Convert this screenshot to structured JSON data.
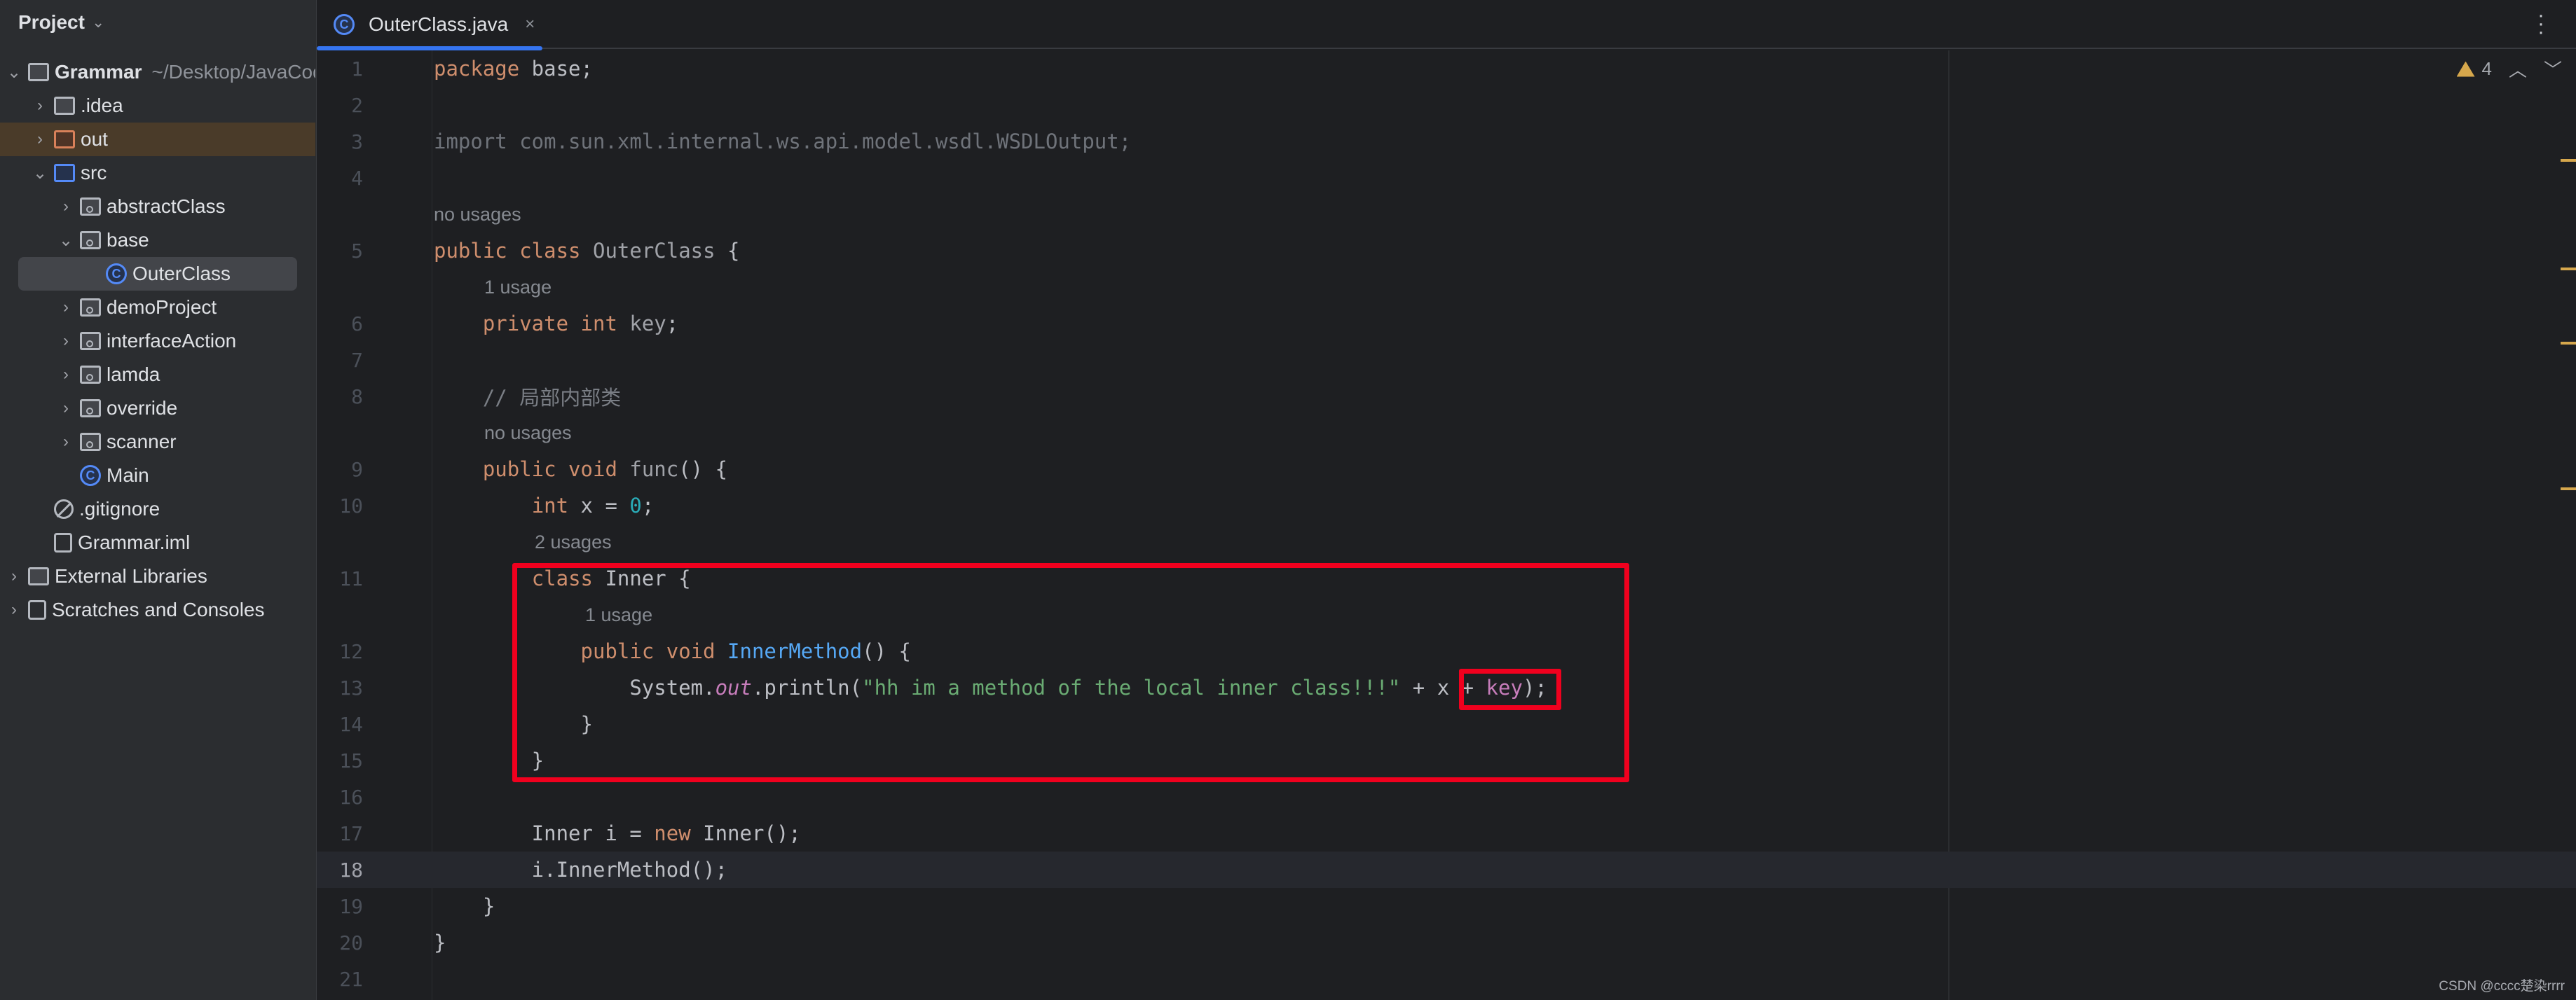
{
  "sidebar": {
    "title": "Project",
    "items": [
      {
        "label": "Grammar",
        "extra": "~/Desktop/JavaCod",
        "level": 0,
        "arrow": "down",
        "icon": "module-folder-icon"
      },
      {
        "label": ".idea",
        "level": 1,
        "arrow": "right",
        "icon": "folder-icon"
      },
      {
        "label": "out",
        "level": 1,
        "arrow": "right",
        "icon": "excluded-folder-icon",
        "highlight": true
      },
      {
        "label": "src",
        "level": 1,
        "arrow": "down",
        "icon": "source-folder-icon"
      },
      {
        "label": "abstractClass",
        "level": 2,
        "arrow": "right",
        "icon": "package-icon"
      },
      {
        "label": "base",
        "level": 2,
        "arrow": "down",
        "icon": "package-icon"
      },
      {
        "label": "OuterClass",
        "level": 3,
        "arrow": "",
        "icon": "class-icon",
        "selected": true
      },
      {
        "label": "demoProject",
        "level": 2,
        "arrow": "right",
        "icon": "package-icon"
      },
      {
        "label": "interfaceAction",
        "level": 2,
        "arrow": "right",
        "icon": "package-icon"
      },
      {
        "label": "lamda",
        "level": 2,
        "arrow": "right",
        "icon": "package-icon"
      },
      {
        "label": "override",
        "level": 2,
        "arrow": "right",
        "icon": "package-icon"
      },
      {
        "label": "scanner",
        "level": 2,
        "arrow": "right",
        "icon": "package-icon"
      },
      {
        "label": "Main",
        "level": 2,
        "arrow": "",
        "icon": "class-icon"
      },
      {
        "label": ".gitignore",
        "level": 1,
        "arrow": "",
        "icon": "ignore-file-icon"
      },
      {
        "label": "Grammar.iml",
        "level": 1,
        "arrow": "",
        "icon": "module-file-icon"
      },
      {
        "label": "External Libraries",
        "level": 0,
        "arrow": "right",
        "icon": "libraries-icon"
      },
      {
        "label": "Scratches and Consoles",
        "level": 0,
        "arrow": "right",
        "icon": "scratches-icon"
      }
    ]
  },
  "tab": {
    "label": "OuterClass.java",
    "close": "×",
    "icon_letter": "C"
  },
  "inspections": {
    "warnings": "4"
  },
  "current_line": "18",
  "rows": [
    {
      "ln": "1",
      "t": [
        [
          "package",
          "k"
        ],
        [
          " base;",
          ""
        ]
      ]
    },
    {
      "ln": "2",
      "t": []
    },
    {
      "ln": "3",
      "t": [
        [
          "import com.sun.xml.internal.ws.api.model.wsdl.WSDLOutput;",
          "g"
        ]
      ]
    },
    {
      "ln": "4",
      "t": []
    },
    {
      "inlay": "no usages",
      "indent": 0
    },
    {
      "ln": "5",
      "t": [
        [
          "public class",
          "k"
        ],
        [
          " ",
          ""
        ],
        [
          "OuterClass",
          "u"
        ],
        [
          " {",
          ""
        ]
      ]
    },
    {
      "inlay": "1 usage",
      "indent": 1
    },
    {
      "ln": "6",
      "t": [
        [
          "    ",
          ""
        ],
        [
          "private int",
          "k"
        ],
        [
          " ",
          ""
        ],
        [
          "key",
          "u"
        ],
        [
          ";",
          ""
        ]
      ]
    },
    {
      "ln": "7",
      "t": []
    },
    {
      "ln": "8",
      "t": [
        [
          "    ",
          ""
        ],
        [
          "// 局部内部类",
          "c"
        ]
      ]
    },
    {
      "inlay": "no usages",
      "indent": 1
    },
    {
      "ln": "9",
      "t": [
        [
          "    ",
          ""
        ],
        [
          "public void",
          "k"
        ],
        [
          " ",
          ""
        ],
        [
          "func",
          "u"
        ],
        [
          "() {",
          ""
        ]
      ]
    },
    {
      "ln": "10",
      "t": [
        [
          "        ",
          ""
        ],
        [
          "int",
          "k"
        ],
        [
          " x = ",
          ""
        ],
        [
          "0",
          "n"
        ],
        [
          ";",
          ""
        ]
      ]
    },
    {
      "inlay": "2 usages",
      "indent": 2
    },
    {
      "ln": "11",
      "t": [
        [
          "        ",
          ""
        ],
        [
          "class",
          "k"
        ],
        [
          " Inner {",
          ""
        ]
      ]
    },
    {
      "inlay": "1 usage",
      "indent": 3
    },
    {
      "ln": "12",
      "t": [
        [
          "            ",
          ""
        ],
        [
          "public void",
          "k"
        ],
        [
          " ",
          ""
        ],
        [
          "InnerMethod",
          "m"
        ],
        [
          "() {",
          ""
        ]
      ]
    },
    {
      "ln": "13",
      "t": [
        [
          "                System.",
          ""
        ],
        [
          "out",
          "fi"
        ],
        [
          ".println(",
          ""
        ],
        [
          "\"hh im a method of the local inner class!!!\"",
          "s"
        ],
        [
          " + x + ",
          ""
        ],
        [
          "key",
          "f"
        ],
        [
          ");",
          ""
        ]
      ]
    },
    {
      "ln": "14",
      "t": [
        [
          "            }",
          ""
        ]
      ]
    },
    {
      "ln": "15",
      "t": [
        [
          "        }",
          ""
        ]
      ]
    },
    {
      "ln": "16",
      "t": []
    },
    {
      "ln": "17",
      "t": [
        [
          "        Inner i = ",
          ""
        ],
        [
          "new",
          "k"
        ],
        [
          " Inner();",
          ""
        ]
      ]
    },
    {
      "ln": "18",
      "t": [
        [
          "        i.InnerMethod();",
          ""
        ]
      ]
    },
    {
      "ln": "19",
      "t": [
        [
          "    }",
          ""
        ]
      ]
    },
    {
      "ln": "20",
      "t": [
        [
          "}",
          ""
        ]
      ]
    },
    {
      "ln": "21",
      "t": []
    }
  ],
  "colors": {
    "accent": "#3574f0",
    "annotation_red": "#f0001e",
    "warning": "#d6a74c"
  },
  "watermark": "CSDN @cccc楚染rrrr"
}
